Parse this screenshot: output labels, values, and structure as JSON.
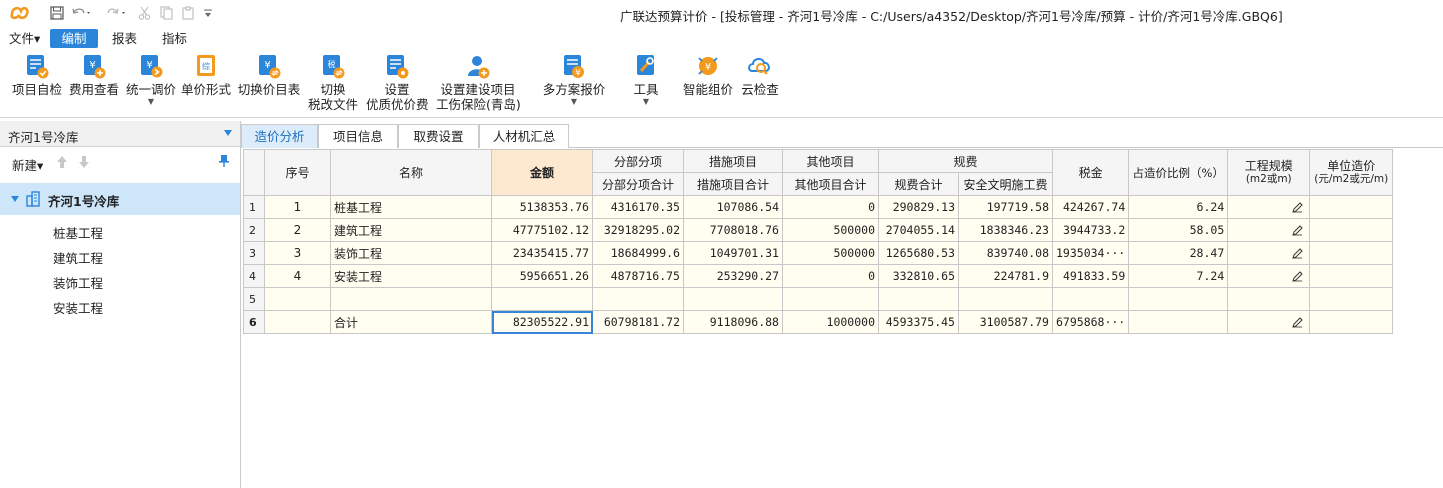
{
  "window": {
    "title": "广联达预算计价 - [投标管理 - 齐河1号冷库 - C:/Users/a4352/Desktop/齐河1号冷库/预算 - 计价/齐河1号冷库.GBQ6]"
  },
  "menu": {
    "items": [
      "文件▾",
      "编制",
      "报表",
      "指标"
    ]
  },
  "ribbon": {
    "buttons": [
      {
        "label": "项目自检",
        "icon": "project-check-icon"
      },
      {
        "label": "费用查看",
        "icon": "cost-view-icon"
      },
      {
        "label": "统一调价",
        "icon": "unified-price-icon",
        "dropdown": true
      },
      {
        "label": "单价形式",
        "icon": "unit-price-form-icon"
      },
      {
        "label": "切换价目表",
        "icon": "switch-price-list-icon"
      },
      {
        "label": "切换",
        "label2": "税改文件",
        "icon": "switch-tax-file-icon"
      },
      {
        "label": "设置",
        "label2": "优质优价费",
        "icon": "settings-quality-fee-icon"
      },
      {
        "label": "设置建设项目",
        "label2": "工伤保险(青岛)",
        "icon": "construction-insurance-icon"
      },
      {
        "label": "多方案报价",
        "icon": "multi-plan-quote-icon",
        "dropdown": true
      },
      {
        "label": "工具",
        "icon": "tools-icon",
        "dropdown": true
      },
      {
        "label": "智能组价",
        "icon": "smart-pricing-icon"
      },
      {
        "label": "云检查",
        "icon": "cloud-check-icon"
      }
    ]
  },
  "left_panel": {
    "project_select": "齐河1号冷库",
    "new_label": "新建▾",
    "tree": {
      "root": "齐河1号冷库",
      "children": [
        "桩基工程",
        "建筑工程",
        "装饰工程",
        "安装工程"
      ]
    }
  },
  "tabs": [
    "造价分析",
    "项目信息",
    "取费设置",
    "人材机汇总"
  ],
  "grid": {
    "headers": {
      "seq": "序号",
      "name": "名称",
      "amount": "金额",
      "group_fbfx": "分部分项",
      "fbfx_total": "分部分项合计",
      "group_csxm": "措施项目",
      "csxm_total": "措施项目合计",
      "group_qtxm": "其他项目",
      "qtxm_total": "其他项目合计",
      "group_gf": "规费",
      "gf_total": "规费合计",
      "aqwm": "安全文明施工费",
      "tax": "税金",
      "ratio": "占造价比例（%）",
      "scale": "工程规模",
      "scale_unit": "(m2或m)",
      "unit_cost": "单位造价",
      "unit_cost_unit": "(元/m2或元/m)"
    },
    "rows": [
      {
        "rn": "1",
        "seq": "1",
        "name": "桩基工程",
        "amount": "5138353.76",
        "fbfx": "4316170.35",
        "csxm": "107086.54",
        "qtxm": "0",
        "gf": "290829.13",
        "aqwm": "197719.58",
        "tax": "424267.74",
        "ratio": "6.24",
        "edit": true
      },
      {
        "rn": "2",
        "seq": "2",
        "name": "建筑工程",
        "amount": "47775102.12",
        "fbfx": "32918295.02",
        "csxm": "7708018.76",
        "qtxm": "500000",
        "gf": "2704055.14",
        "aqwm": "1838346.23",
        "tax": "3944733.2",
        "ratio": "58.05",
        "edit": true
      },
      {
        "rn": "3",
        "seq": "3",
        "name": "装饰工程",
        "amount": "23435415.77",
        "fbfx": "18684999.6",
        "csxm": "1049701.31",
        "qtxm": "500000",
        "gf": "1265680.53",
        "aqwm": "839740.08",
        "tax": "1935034···",
        "ratio": "28.47",
        "edit": true
      },
      {
        "rn": "4",
        "seq": "4",
        "name": "安装工程",
        "amount": "5956651.26",
        "fbfx": "4878716.75",
        "csxm": "253290.27",
        "qtxm": "0",
        "gf": "332810.65",
        "aqwm": "224781.9",
        "tax": "491833.59",
        "ratio": "7.24",
        "edit": true
      },
      {
        "rn": "5",
        "seq": "",
        "name": "",
        "amount": "",
        "fbfx": "",
        "csxm": "",
        "qtxm": "",
        "gf": "",
        "aqwm": "",
        "tax": "",
        "ratio": "",
        "edit": false
      },
      {
        "rn": "6",
        "seq": "",
        "name": "合计",
        "amount": "82305522.91",
        "fbfx": "60798181.72",
        "csxm": "9118096.88",
        "qtxm": "1000000",
        "gf": "4593375.45",
        "aqwm": "3100587.79",
        "tax": "6795868···",
        "ratio": "",
        "edit": true
      }
    ]
  },
  "colors": {
    "accent": "#2b86d9",
    "tree_selected": "#cde6fa",
    "amount_header": "#fde9cf",
    "cell_bg": "#fffef0"
  }
}
